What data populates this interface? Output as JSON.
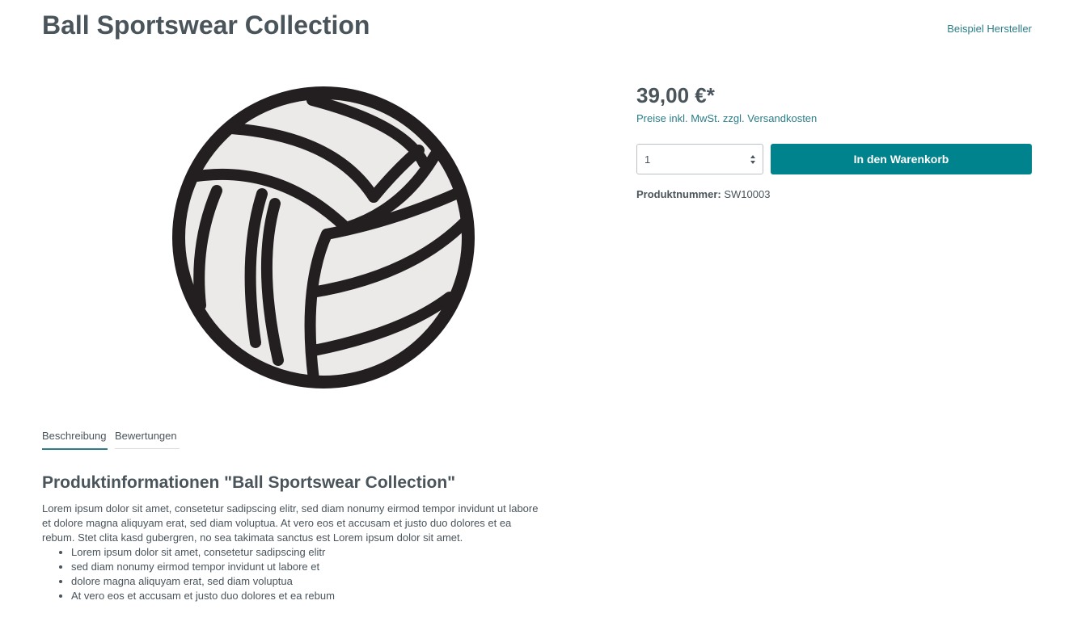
{
  "product": {
    "title": "Ball Sportswear Collection",
    "manufacturer": "Beispiel Hersteller",
    "image_icon": "volleyball-icon",
    "price": "39,00 €*",
    "tax_note": "Preise inkl. MwSt. zzgl. Versandkosten",
    "quantity": "1",
    "add_to_cart_label": "In den Warenkorb",
    "product_number_label": "Produktnummer:",
    "product_number": "SW10003"
  },
  "tabs": [
    {
      "label": "Beschreibung",
      "active": true
    },
    {
      "label": "Bewertungen",
      "active": false
    }
  ],
  "description": {
    "heading": "Produktinformationen \"Ball Sportswear Collection\"",
    "text": "Lorem ipsum dolor sit amet, consetetur sadipscing elitr, sed diam nonumy eirmod tempor invidunt ut labore et dolore magna aliquyam erat, sed diam voluptua. At vero eos et accusam et justo duo dolores et ea rebum. Stet clita kasd gubergren, no sea takimata sanctus est Lorem ipsum dolor sit amet.",
    "list": [
      "Lorem ipsum dolor sit amet, consetetur sadipscing elitr",
      "sed diam nonumy eirmod tempor invidunt ut labore et",
      "dolore magna aliquyam erat, sed diam voluptua",
      "At vero eos et accusam et justo duo dolores et ea rebum"
    ]
  },
  "colors": {
    "accent": "#00838c",
    "link": "#2b7d88",
    "text": "#4a545b",
    "ball_fill": "#ebeae8",
    "ball_stroke": "#231f20"
  }
}
